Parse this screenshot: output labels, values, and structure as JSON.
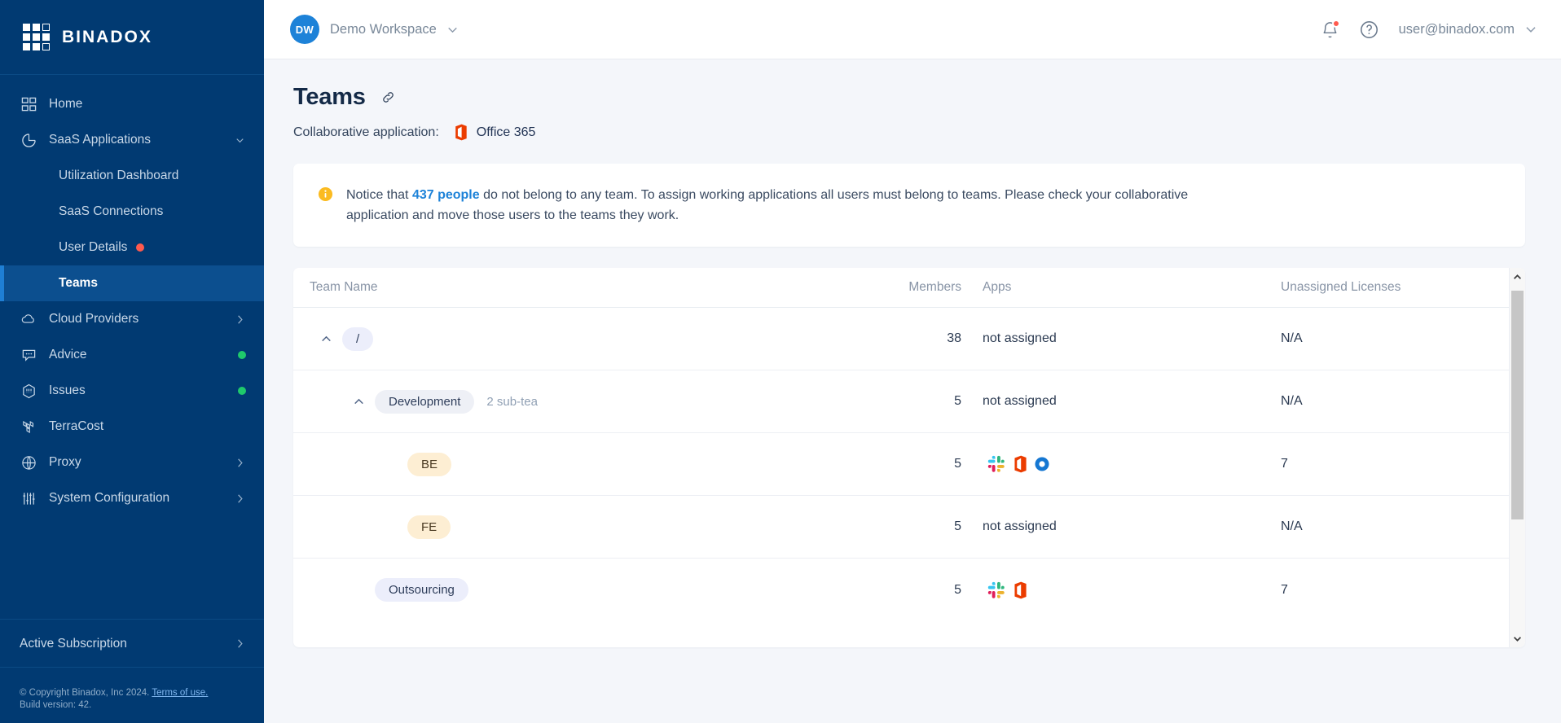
{
  "brand": {
    "name": "BINADOX"
  },
  "sidebar": {
    "items": [
      {
        "label": "Home",
        "icon": "grid-icon",
        "type": "item"
      },
      {
        "label": "SaaS Applications",
        "icon": "pie-chart-icon",
        "type": "item",
        "chevron": "down"
      },
      {
        "label": "Utilization Dashboard",
        "type": "sub"
      },
      {
        "label": "SaaS Connections",
        "type": "sub"
      },
      {
        "label": "User Details",
        "type": "sub",
        "dot": "red"
      },
      {
        "label": "Teams",
        "type": "sub",
        "active": true
      },
      {
        "label": "Cloud Providers",
        "icon": "cloud-icon",
        "type": "item",
        "chevron": "right"
      },
      {
        "label": "Advice",
        "icon": "chat-icon",
        "type": "item",
        "dot": "green"
      },
      {
        "label": "Issues",
        "icon": "hexagon-alert-icon",
        "type": "item",
        "dot": "green"
      },
      {
        "label": "TerraCost",
        "icon": "terraform-icon",
        "type": "item"
      },
      {
        "label": "Proxy",
        "icon": "globe-icon",
        "type": "item",
        "chevron": "right"
      },
      {
        "label": "System Configuration",
        "icon": "sliders-icon",
        "type": "item",
        "chevron": "right"
      }
    ],
    "subscription": {
      "label": "Active Subscription",
      "chevron": "right"
    },
    "footer": {
      "copyright": "© Copyright Binadox, Inc 2024.",
      "terms_link": "Terms of use.",
      "build": "Build version: 42."
    }
  },
  "topbar": {
    "workspace_initials": "DW",
    "workspace_name": "Demo Workspace",
    "user_email": "user@binadox.com"
  },
  "page": {
    "title": "Teams",
    "collaborative_label": "Collaborative application:",
    "collaborative_app": "Office 365"
  },
  "notice": {
    "prefix": "Notice that ",
    "highlight": "437 people",
    "suffix": " do not belong to any team. To assign working applications all users must belong to teams. Please check your collaborative application and move those users to the teams they work."
  },
  "table": {
    "columns": {
      "team_name": "Team Name",
      "members": "Members",
      "apps": "Apps",
      "unassigned_licenses": "Unassigned Licenses"
    },
    "rows": [
      {
        "name": "/",
        "badge_style": "lav",
        "indent": 0,
        "expander": "chevron-up-icon",
        "subcount": "",
        "members": "38",
        "apps_text": "not assigned",
        "apps_icons": [],
        "licenses": "N/A"
      },
      {
        "name": "Development",
        "badge_style": "gray",
        "indent": 1,
        "expander": "chevron-up-icon",
        "subcount": "2 sub-tea",
        "members": "5",
        "apps_text": "not assigned",
        "apps_icons": [],
        "licenses": "N/A"
      },
      {
        "name": "BE",
        "badge_style": "cream",
        "indent": 2,
        "expander": "",
        "subcount": "",
        "members": "5",
        "apps_text": "",
        "apps_icons": [
          "slack-icon",
          "office365-icon",
          "okta-icon"
        ],
        "licenses": "7"
      },
      {
        "name": "FE",
        "badge_style": "cream",
        "indent": 2,
        "expander": "",
        "subcount": "",
        "members": "5",
        "apps_text": "not assigned",
        "apps_icons": [],
        "licenses": "N/A"
      },
      {
        "name": "Outsourcing",
        "badge_style": "lav",
        "indent": 1,
        "expander": "",
        "subcount": "",
        "members": "5",
        "apps_text": "",
        "apps_icons": [
          "slack-icon",
          "office365-icon"
        ],
        "licenses": "7"
      }
    ]
  },
  "colors": {
    "sidebar_bg": "#013a72",
    "sidebar_active": "#0c4f8f",
    "accent_blue": "#1d82d8",
    "notice_icon": "#fbbb21",
    "alert_red": "#ff5a4e",
    "status_green": "#1fc96b",
    "office_orange": "#e64a19",
    "page_bg": "#f4f6fa"
  }
}
